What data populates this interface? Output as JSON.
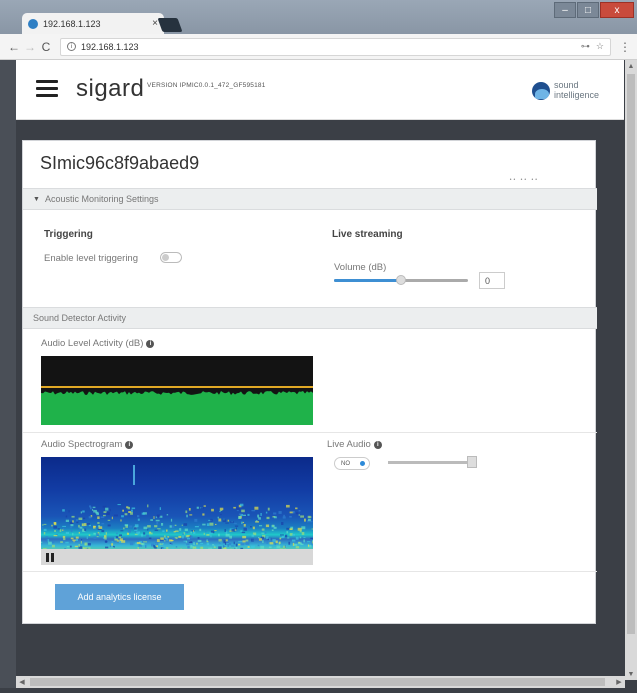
{
  "browser": {
    "tab_title": "192.168.1.123",
    "tab_close": "×",
    "url": "192.168.1.123",
    "back": "←",
    "forward": "→",
    "reload": "C",
    "info": "i",
    "key_icon": "⊶",
    "star_icon": "☆",
    "menu": "⋮",
    "win_min": "–",
    "win_max": "□",
    "win_close": "x"
  },
  "header": {
    "brand": "sigard",
    "version": "VERSION IPMIC0.0.1_472_GF595181",
    "logo_line1": "sound",
    "logo_line2": "intelligence"
  },
  "device": {
    "name": "SImic96c8f9abaed9",
    "dots": "•• •• ••"
  },
  "acoustic": {
    "section_title": "Acoustic Monitoring Settings",
    "caret": "▼",
    "triggering_title": "Triggering",
    "enable_level_label": "Enable level triggering",
    "enable_level_on": false,
    "live_streaming_title": "Live streaming",
    "volume_label": "Volume (dB)",
    "volume_value": "0",
    "volume_fraction": 0.5
  },
  "activity": {
    "section_title": "Sound Detector Activity",
    "audio_level_label": "Audio Level Activity (dB)",
    "spectrogram_label": "Audio Spectrogram",
    "live_audio_label": "Live Audio",
    "live_audio_toggle": "NO",
    "info_glyph": "i"
  },
  "actions": {
    "add_license": "Add analytics license"
  },
  "scroll": {
    "up": "▲",
    "down": "▼",
    "left": "◀",
    "right": "▶"
  },
  "colors": {
    "accent": "#5fa2d8",
    "meter_fill": "#1fb24a",
    "meter_threshold": "#e0a825"
  }
}
